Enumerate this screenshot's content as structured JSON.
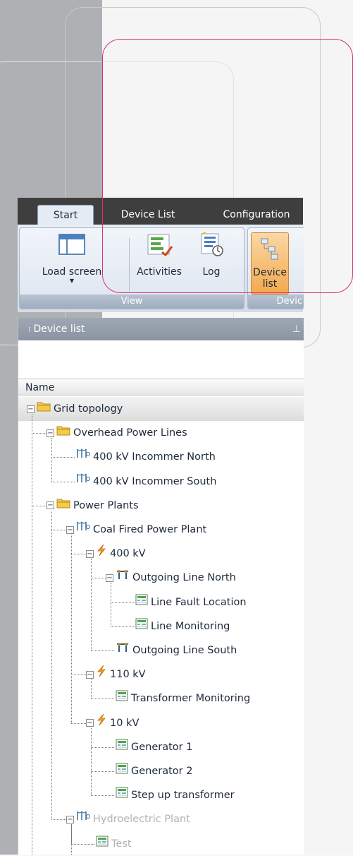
{
  "tabs": [
    "Start",
    "Device List",
    "Configuration"
  ],
  "ribbon": {
    "view_group": {
      "label": "View",
      "load_screen": "Load screen",
      "activities": "Activities",
      "log": "Log"
    },
    "device_group": {
      "label": "Devic",
      "device_list_line1": "Device",
      "device_list_line2": "list"
    }
  },
  "pane": {
    "title": "Device list",
    "column_header": "Name"
  },
  "tree": [
    {
      "label": "Grid topology",
      "icon": "folder-icon"
    },
    {
      "label": "Overhead Power Lines",
      "icon": "folder-icon"
    },
    {
      "label": "400 kV Incommer North",
      "icon": "power-line-icon"
    },
    {
      "label": "400 kV Incommer South",
      "icon": "power-line-icon"
    },
    {
      "label": "Power Plants",
      "icon": "folder-icon"
    },
    {
      "label": "Coal Fired Power Plant",
      "icon": "power-line-icon"
    },
    {
      "label": "400 kV",
      "icon": "lightning-icon"
    },
    {
      "label": "Outgoing Line North",
      "icon": "tower-icon"
    },
    {
      "label": "Line Fault Location",
      "icon": "device-icon"
    },
    {
      "label": "Line Monitoring",
      "icon": "device-icon"
    },
    {
      "label": "Outgoing Line South",
      "icon": "tower-icon"
    },
    {
      "label": "110 kV",
      "icon": "lightning-icon"
    },
    {
      "label": "Transformer Monitoring",
      "icon": "device-icon"
    },
    {
      "label": "10 kV",
      "icon": "lightning-icon"
    },
    {
      "label": "Generator 1",
      "icon": "device-icon"
    },
    {
      "label": "Generator 2",
      "icon": "device-icon"
    },
    {
      "label": "Step up transformer",
      "icon": "device-icon"
    },
    {
      "label": "Hydroelectric Plant",
      "icon": "power-line-icon"
    },
    {
      "label": "Test",
      "icon": "device-icon"
    }
  ],
  "colors": {
    "accent_selected": "#f3a94e",
    "tab_bar": "#3e3e3e",
    "ribbon": "#dde5ef",
    "pane_title": "#8b95a2"
  }
}
